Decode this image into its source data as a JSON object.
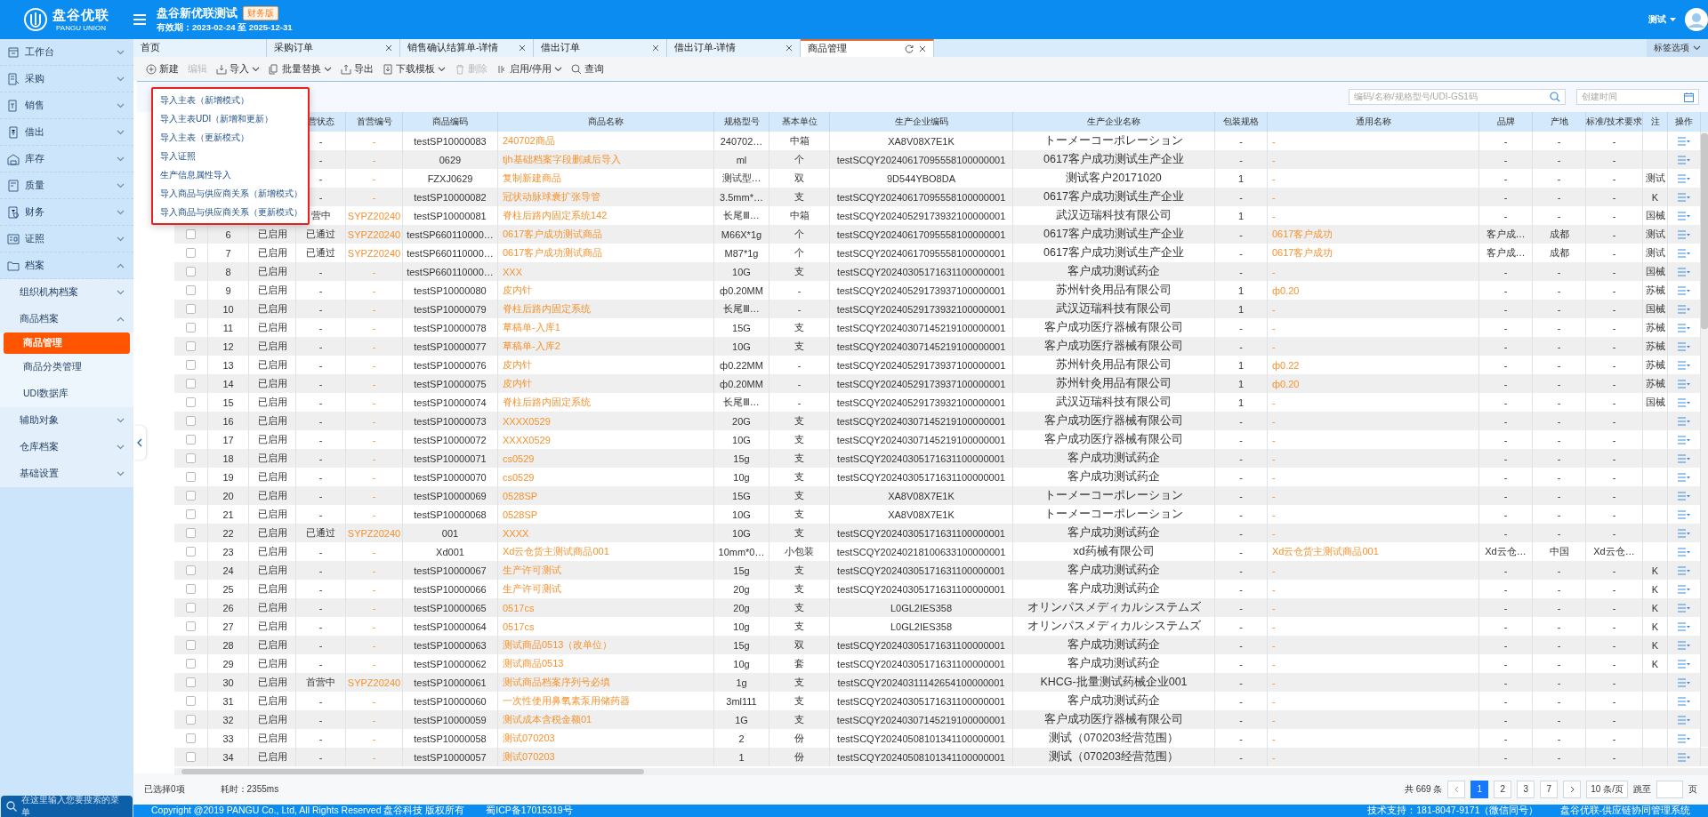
{
  "header": {
    "logo_text": "盘谷优联",
    "logo_subtext": "PANGU UNION",
    "title": "盘谷新优联测试",
    "edition_badge": "财务版",
    "validity": "有效期：2023-02-24 至 2025-12-31",
    "user": "测试"
  },
  "sidebar": {
    "items": [
      {
        "label": "工作台",
        "expanded": false
      },
      {
        "label": "采购",
        "expanded": false
      },
      {
        "label": "销售",
        "expanded": false
      },
      {
        "label": "借出",
        "expanded": false
      },
      {
        "label": "库存",
        "expanded": false
      },
      {
        "label": "质量",
        "expanded": false
      },
      {
        "label": "财务",
        "expanded": false
      },
      {
        "label": "证照",
        "expanded": false
      },
      {
        "label": "档案",
        "expanded": true,
        "children": [
          {
            "label": "组织机构档案",
            "expanded": false
          },
          {
            "label": "商品档案",
            "expanded": true,
            "children": [
              {
                "label": "商品管理",
                "selected": true
              },
              {
                "label": "商品分类管理",
                "selected": false
              },
              {
                "label": "UDI数据库",
                "selected": false
              }
            ]
          },
          {
            "label": "辅助对象",
            "expanded": false
          },
          {
            "label": "仓库档案",
            "expanded": false
          },
          {
            "label": "基础设置",
            "expanded": false
          }
        ]
      }
    ],
    "search_placeholder": "在这里输入您要搜索的菜单"
  },
  "tabs": [
    {
      "label": "首页",
      "selected": false,
      "closable": false
    },
    {
      "label": "采购订单",
      "selected": false,
      "closable": true
    },
    {
      "label": "销售确认结算单-详情",
      "selected": false,
      "closable": true
    },
    {
      "label": "借出订单",
      "selected": false,
      "closable": true
    },
    {
      "label": "借出订单-详情",
      "selected": false,
      "closable": true
    },
    {
      "label": "商品管理",
      "selected": true,
      "closable": true
    }
  ],
  "tab_options": "标签选项",
  "toolbar": [
    {
      "label": "新建",
      "disabled": false,
      "dropdown": false
    },
    {
      "label": "编辑",
      "disabled": true,
      "dropdown": false
    },
    {
      "label": "导入",
      "disabled": false,
      "dropdown": true
    },
    {
      "label": "批量替换",
      "disabled": false,
      "dropdown": true
    },
    {
      "label": "导出",
      "disabled": false,
      "dropdown": false
    },
    {
      "label": "下载模板",
      "disabled": false,
      "dropdown": true
    },
    {
      "label": "删除",
      "disabled": true,
      "dropdown": false
    },
    {
      "label": "启用/停用",
      "disabled": false,
      "dropdown": true
    },
    {
      "label": "查询",
      "disabled": false,
      "dropdown": false
    }
  ],
  "import_menu": {
    "items": [
      "导入主表（新增模式）",
      "导入主表UDI（新增和更新）",
      "导入主表（更新模式）",
      "导入证照",
      "生产信息属性导入",
      "导入商品与供应商关系（新增模式）",
      "导入商品与供应商关系（更新模式）"
    ]
  },
  "filter": {
    "search_placeholder": "编码/名称/规格型号/UDI-GS1码",
    "date_placeholder": "创建时间"
  },
  "table": {
    "columns": [
      {
        "kind": "text"
      },
      {
        "kind": "text"
      },
      {
        "label": "营状态",
        "kind": "text"
      },
      {
        "label": "首营编号",
        "kind": "ref"
      },
      {
        "label": "商品编码",
        "kind": "text"
      },
      {
        "label": "商品名称",
        "kind": "link"
      },
      {
        "label": "规格型号",
        "kind": "text"
      },
      {
        "label": "基本单位",
        "kind": "text"
      },
      {
        "label": "生产企业编码",
        "kind": "text"
      },
      {
        "label": "生产企业名称",
        "kind": "text"
      },
      {
        "label": "包装规格",
        "kind": "text"
      },
      {
        "label": "通用名称",
        "kind": "link"
      },
      {
        "label": "品牌",
        "kind": "text"
      },
      {
        "label": "产地",
        "kind": "text"
      },
      {
        "label": "标准/技术要求",
        "kind": "text"
      },
      {
        "label": "注",
        "kind": "text"
      }
    ],
    "action_header": "操作",
    "rows": [
      {
        "cells": [
          null,
          null,
          "-",
          "-",
          "testSP10000083",
          "240702商品",
          "240702…",
          "中箱",
          "XA8V08X7E1K",
          "トーメーコーポレーション",
          "-",
          "-",
          "-",
          "-",
          "-",
          null
        ]
      },
      {
        "cells": [
          null,
          null,
          "-",
          "-",
          "0629",
          "tjh基础档案字段删减后导入",
          "ml",
          "个",
          "testSCQY20240617095558100000001",
          "0617客户成功测试生产企业",
          "-",
          "-",
          "-",
          "-",
          "-",
          null
        ]
      },
      {
        "cells": [
          null,
          null,
          "-",
          "-",
          "FZXJ0629",
          "复制新建商品",
          "测试型…",
          "双",
          "9D544YBO8DA",
          "测试客户20171020",
          "1",
          "-",
          "-",
          "-",
          "-",
          "测试"
        ]
      },
      {
        "cells": [
          null,
          null,
          "-",
          "-",
          "testSP10000082",
          "冠状动脉球囊扩张导管",
          "3.5mm*…",
          "支",
          "testSCQY20240617095558100000001",
          "0617客户成功测试生产企业",
          "-",
          "-",
          "-",
          "-",
          "-",
          "K"
        ]
      },
      {
        "cells": [
          null,
          null,
          "营中",
          "SYPZ20240",
          "testSP10000081",
          "脊柱后路内固定系统142",
          "长尾Ⅲ…",
          "中箱",
          "testSCQY20240529173932100000001",
          "武汉迈瑞科技有限公司",
          "1",
          "-",
          "-",
          "-",
          "-",
          "国械"
        ]
      },
      {
        "checked": false,
        "cells": [
          "6",
          "已启用",
          "已通过",
          "SYPZ20240",
          "testSP660110000…",
          "0617客户成功测试商品",
          "M66X*1g",
          "个",
          "testSCQY20240617095558100000001",
          "0617客户成功测试生产企业",
          "-",
          "0617客户成功",
          "客户成…",
          "成都",
          "-",
          "测试"
        ]
      },
      {
        "checked": false,
        "cells": [
          "7",
          "已启用",
          "已通过",
          "SYPZ20240",
          "testSP660110000…",
          "0617客户成功测试商品",
          "M87*1g",
          "个",
          "testSCQY20240617095558100000001",
          "0617客户成功测试生产企业",
          "-",
          "0617客户成功",
          "客户成…",
          "成都",
          "-",
          "测试"
        ]
      },
      {
        "checked": false,
        "cells": [
          "8",
          "已启用",
          "-",
          "-",
          "testSP660110000…",
          "XXX",
          "10G",
          "支",
          "testSCQY20240305171631100000001",
          "客户成功测试药企",
          "-",
          "-",
          "-",
          "-",
          "-",
          "国械"
        ]
      },
      {
        "checked": false,
        "cells": [
          "9",
          "已启用",
          "-",
          "-",
          "testSP10000080",
          "皮内针",
          "ф0.20MM",
          "-",
          "testSCQY20240529173937100000001",
          "苏州针灸用品有限公司",
          "1",
          "ф0.20",
          "-",
          "-",
          "-",
          "苏械"
        ]
      },
      {
        "checked": false,
        "cells": [
          "10",
          "已启用",
          "-",
          "-",
          "testSP10000079",
          "脊柱后路内固定系统",
          "长尾Ⅲ…",
          "-",
          "testSCQY20240529173932100000001",
          "武汉迈瑞科技有限公司",
          "1",
          "-",
          "-",
          "-",
          "-",
          "国械"
        ]
      },
      {
        "checked": false,
        "cells": [
          "11",
          "已启用",
          "-",
          "-",
          "testSP10000078",
          "草稿单-入库1",
          "15G",
          "支",
          "testSCQY20240307145219100000001",
          "客户成功医疗器械有限公司",
          "-",
          "-",
          "-",
          "-",
          "-",
          "苏械"
        ]
      },
      {
        "checked": false,
        "cells": [
          "12",
          "已启用",
          "-",
          "-",
          "testSP10000077",
          "草稿单-入库2",
          "10G",
          "支",
          "testSCQY20240307145219100000001",
          "客户成功医疗器械有限公司",
          "-",
          "-",
          "-",
          "-",
          "-",
          "苏械"
        ]
      },
      {
        "checked": false,
        "cells": [
          "13",
          "已启用",
          "-",
          "-",
          "testSP10000076",
          "皮内针",
          "ф0.22MM",
          "-",
          "testSCQY20240529173937100000001",
          "苏州针灸用品有限公司",
          "1",
          "ф0.22",
          "-",
          "-",
          "-",
          "苏械"
        ]
      },
      {
        "checked": false,
        "cells": [
          "14",
          "已启用",
          "-",
          "-",
          "testSP10000075",
          "皮内针",
          "ф0.20MM",
          "-",
          "testSCQY20240529173937100000001",
          "苏州针灸用品有限公司",
          "1",
          "ф0.20",
          "-",
          "-",
          "-",
          "苏械"
        ]
      },
      {
        "checked": false,
        "cells": [
          "15",
          "已启用",
          "-",
          "-",
          "testSP10000074",
          "脊柱后路内固定系统",
          "长尾Ⅲ…",
          "-",
          "testSCQY20240529173932100000001",
          "武汉迈瑞科技有限公司",
          "1",
          "-",
          "-",
          "-",
          "-",
          "国械"
        ]
      },
      {
        "checked": false,
        "cells": [
          "16",
          "已启用",
          "-",
          "-",
          "testSP10000073",
          "XXXX0529",
          "20G",
          "支",
          "testSCQY20240307145219100000001",
          "客户成功医疗器械有限公司",
          "-",
          "-",
          "-",
          "-",
          "-",
          null
        ]
      },
      {
        "checked": false,
        "cells": [
          "17",
          "已启用",
          "-",
          "-",
          "testSP10000072",
          "XXXX0529",
          "10G",
          "支",
          "testSCQY20240307145219100000001",
          "客户成功医疗器械有限公司",
          "-",
          "-",
          "-",
          "-",
          "-",
          null
        ]
      },
      {
        "checked": false,
        "cells": [
          "18",
          "已启用",
          "-",
          "-",
          "testSP10000071",
          "cs0529",
          "15g",
          "支",
          "testSCQY20240305171631100000001",
          "客户成功测试药企",
          "-",
          "-",
          "-",
          "-",
          "-",
          null
        ]
      },
      {
        "checked": false,
        "cells": [
          "19",
          "已启用",
          "-",
          "-",
          "testSP10000070",
          "cs0529",
          "10g",
          "支",
          "testSCQY20240305171631100000001",
          "客户成功测试药企",
          "-",
          "-",
          "-",
          "-",
          "-",
          null
        ]
      },
      {
        "checked": false,
        "cells": [
          "20",
          "已启用",
          "-",
          "-",
          "testSP10000069",
          "0528SP",
          "15G",
          "支",
          "XA8V08X7E1K",
          "トーメーコーポレーション",
          "-",
          "-",
          "-",
          "-",
          "-",
          null
        ]
      },
      {
        "checked": false,
        "cells": [
          "21",
          "已启用",
          "-",
          "-",
          "testSP10000068",
          "0528SP",
          "10G",
          "支",
          "XA8V08X7E1K",
          "トーメーコーポレーション",
          "-",
          "-",
          "-",
          "-",
          "-",
          null
        ]
      },
      {
        "checked": false,
        "cells": [
          "22",
          "已启用",
          "已通过",
          "SYPZ20240",
          "001",
          "XXXX",
          "10G",
          "支",
          "testSCQY20240305171631100000001",
          "客户成功测试药企",
          "-",
          "-",
          "-",
          "-",
          "-",
          null
        ]
      },
      {
        "checked": false,
        "cells": [
          "23",
          "已启用",
          "-",
          "-",
          "Xd001",
          "Xd云仓货主测试商品001",
          "10mm*0…",
          "小包装",
          "testSCQY20240218100633100000001",
          "xd药械有限公司",
          "-",
          "Xd云仓货主测试商品001",
          "Xd云仓…",
          "中国",
          "Xd云仓…",
          null
        ]
      },
      {
        "checked": false,
        "cells": [
          "24",
          "已启用",
          "-",
          "-",
          "testSP10000067",
          "生产许可测试",
          "15g",
          "支",
          "testSCQY20240305171631100000001",
          "客户成功测试药企",
          "-",
          "-",
          "-",
          "-",
          "-",
          "K"
        ]
      },
      {
        "checked": false,
        "cells": [
          "25",
          "已启用",
          "-",
          "-",
          "testSP10000066",
          "生产许可测试",
          "20g",
          "支",
          "testSCQY20240305171631100000001",
          "客户成功测试药企",
          "-",
          "-",
          "-",
          "-",
          "-",
          "K"
        ]
      },
      {
        "checked": false,
        "cells": [
          "26",
          "已启用",
          "-",
          "-",
          "testSP10000065",
          "0517cs",
          "20g",
          "支",
          "L0GL2IES358",
          "オリンパスメディカルシステムズ",
          "-",
          "-",
          "-",
          "-",
          "-",
          "K"
        ]
      },
      {
        "checked": false,
        "cells": [
          "27",
          "已启用",
          "-",
          "-",
          "testSP10000064",
          "0517cs",
          "10g",
          "支",
          "L0GL2IES358",
          "オリンパスメディカルシステムズ",
          "-",
          "-",
          "-",
          "-",
          "-",
          "K"
        ]
      },
      {
        "checked": false,
        "cells": [
          "28",
          "已启用",
          "-",
          "-",
          "testSP10000063",
          "测试商品0513（改单位）",
          "15g",
          "双",
          "testSCQY20240305171631100000001",
          "客户成功测试药企",
          "-",
          "-",
          "-",
          "-",
          "-",
          "K"
        ]
      },
      {
        "checked": false,
        "cells": [
          "29",
          "已启用",
          "-",
          "-",
          "testSP10000062",
          "测试商品0513",
          "10g",
          "套",
          "testSCQY20240305171631100000001",
          "客户成功测试药企",
          "-",
          "-",
          "-",
          "-",
          "-",
          "K"
        ]
      },
      {
        "checked": false,
        "cells": [
          "30",
          "已启用",
          "首营中",
          "SYPZ20240",
          "testSP10000061",
          "测试商品档案序列号必填",
          "1g",
          "支",
          "testSCQY20240311142654100000001",
          "KHCG-批量测试药械企业001",
          "-",
          "-",
          "-",
          "-",
          "-",
          null
        ]
      },
      {
        "checked": false,
        "cells": [
          "31",
          "已启用",
          "-",
          "-",
          "testSP10000060",
          "一次性使用鼻氧素泵用储药器",
          "3ml111",
          "支",
          "testSCQY20240305171631100000001",
          "客户成功测试药企",
          "-",
          "-",
          "-",
          "-",
          "-",
          null
        ]
      },
      {
        "checked": false,
        "cells": [
          "32",
          "已启用",
          "-",
          "-",
          "testSP10000059",
          "测试成本含税金额01",
          "1G",
          "支",
          "testSCQY20240307145219100000001",
          "客户成功医疗器械有限公司",
          "-",
          "-",
          "-",
          "-",
          "-",
          null
        ]
      },
      {
        "checked": false,
        "cells": [
          "33",
          "已启用",
          "-",
          "-",
          "testSP10000058",
          "测试070203",
          "2",
          "份",
          "testSCQY20240508101341100000001",
          "测试（070203经营范围）",
          "-",
          "-",
          "-",
          "-",
          "-",
          null
        ]
      },
      {
        "checked": false,
        "cells": [
          "34",
          "已启用",
          "-",
          "-",
          "testSP10000057",
          "测试070203",
          "1",
          "份",
          "testSCQY20240508101341100000001",
          "测试（070203经营范围）",
          "-",
          "-",
          "-",
          "-",
          "-",
          null
        ]
      }
    ]
  },
  "status_bar": {
    "selected_count": "已选择0项",
    "elapsed": "耗时：2355ms",
    "total": "共 669 条",
    "pages": [
      {
        "label": "1",
        "selected": true
      },
      {
        "label": "2",
        "selected": false
      },
      {
        "label": "3",
        "selected": false
      },
      {
        "label": "7",
        "selected": false
      }
    ],
    "page_size": "10 条/页",
    "jump": "跳至",
    "page_suffix": "页"
  },
  "footer": {
    "copyright": "Copyright @2019 PANGU Co., Ltd, All Rights Reserved 盘谷科技 版权所有",
    "icp": "蜀ICP备17015319号",
    "support": "技术支持：181-8047-9171（微信同号）",
    "system": "盘谷优联-供应链协同管理系统"
  }
}
